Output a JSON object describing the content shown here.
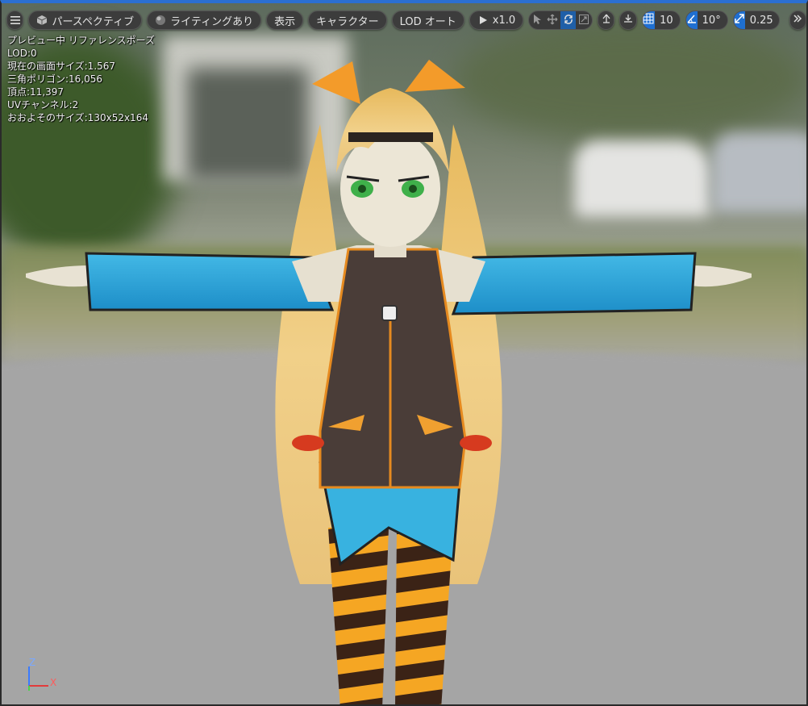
{
  "toolbar": {
    "menu_icon": "hamburger-icon",
    "view_mode_label": "パースペクティブ",
    "lighting_label": "ライティングあり",
    "show_label": "表示",
    "character_label": "キャラクター",
    "lod_label": "LOD オート",
    "playback_label": "x1.0",
    "grid_snap_value": "10",
    "rotation_snap_value": "10°",
    "scale_snap_value": "0.25",
    "accent_color": "#1f6fd1"
  },
  "stats": {
    "preview": "プレビュー中 リファレンスポーズ",
    "lod": "LOD:0",
    "screen_size": "現在の画面サイズ:1.567",
    "triangles": "三角ポリゴン:16,056",
    "vertices": "頂点:11,397",
    "uv_channels": "UVチャンネル:2",
    "approx_size": "おおよそのサイズ:130x52x164"
  },
  "gizmo": {
    "z_label": "Z",
    "x_label": "X"
  }
}
